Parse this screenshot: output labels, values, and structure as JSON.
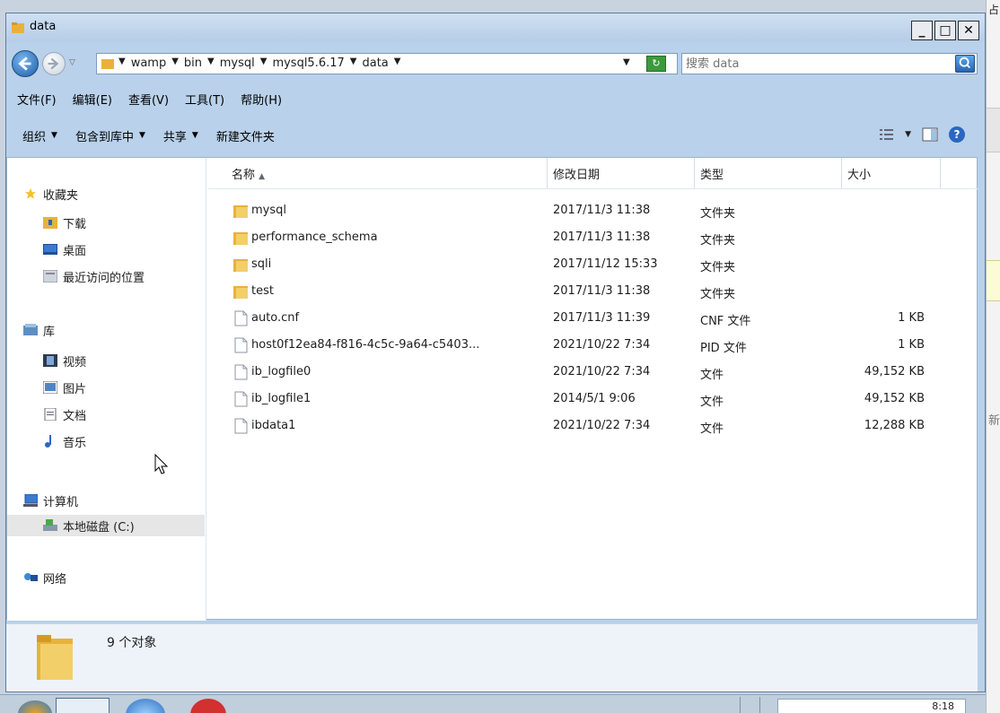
{
  "window": {
    "title": "data"
  },
  "address": {
    "crumbs": [
      "wamp",
      "bin",
      "mysql",
      "mysql5.6.17",
      "data"
    ],
    "search_placeholder": "搜索 data"
  },
  "menu": [
    "文件(F)",
    "编辑(E)",
    "查看(V)",
    "工具(T)",
    "帮助(H)"
  ],
  "toolbar": {
    "organize": "组织",
    "include": "包含到库中",
    "share": "共享",
    "new_folder": "新建文件夹"
  },
  "nav": {
    "favorites": "收藏夹",
    "downloads": "下载",
    "desktop": "桌面",
    "recent": "最近访问的位置",
    "libraries": "库",
    "videos": "视频",
    "pictures": "图片",
    "documents": "文档",
    "music": "音乐",
    "computer": "计算机",
    "local_disk": "本地磁盘 (C:)",
    "network": "网络"
  },
  "columns": {
    "name": "名称",
    "modified": "修改日期",
    "type": "类型",
    "size": "大小"
  },
  "files": [
    {
      "name": "mysql",
      "modified": "2017/11/3 11:38",
      "type": "文件夹",
      "size": "",
      "icon": "folder"
    },
    {
      "name": "performance_schema",
      "modified": "2017/11/3 11:38",
      "type": "文件夹",
      "size": "",
      "icon": "folder"
    },
    {
      "name": "sqli",
      "modified": "2017/11/12 15:33",
      "type": "文件夹",
      "size": "",
      "icon": "folder"
    },
    {
      "name": "test",
      "modified": "2017/11/3 11:38",
      "type": "文件夹",
      "size": "",
      "icon": "folder"
    },
    {
      "name": "auto.cnf",
      "modified": "2017/11/3 11:39",
      "type": "CNF 文件",
      "size": "1 KB",
      "icon": "file"
    },
    {
      "name": "host0f12ea84-f816-4c5c-9a64-c5403...",
      "modified": "2021/10/22 7:34",
      "type": "PID 文件",
      "size": "1 KB",
      "icon": "file"
    },
    {
      "name": "ib_logfile0",
      "modified": "2021/10/22 7:34",
      "type": "文件",
      "size": "49,152 KB",
      "icon": "file"
    },
    {
      "name": "ib_logfile1",
      "modified": "2014/5/1 9:06",
      "type": "文件",
      "size": "49,152 KB",
      "icon": "file"
    },
    {
      "name": "ibdata1",
      "modified": "2021/10/22 7:34",
      "type": "文件",
      "size": "12,288 KB",
      "icon": "file"
    }
  ],
  "status": {
    "count": "9 个对象"
  },
  "edge": {
    "top_char": "占",
    "mid_char": "新"
  },
  "taskbar": {
    "clock": "8:18"
  },
  "colors": {
    "titlebar": "#b9d1ea",
    "folder": "#e8b23a",
    "accent": "#2a67c1"
  }
}
